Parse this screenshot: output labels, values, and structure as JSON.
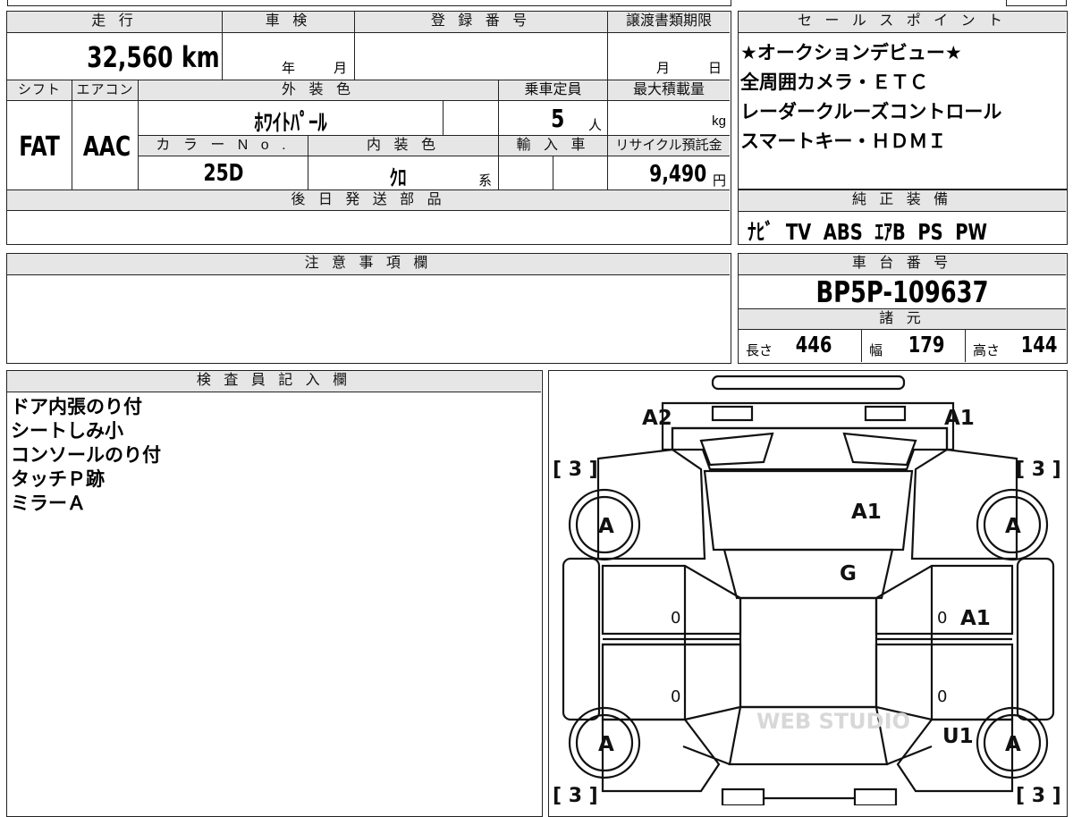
{
  "mileage": {
    "label": "走 行",
    "value": "32,560",
    "unit": "km"
  },
  "shaken": {
    "label": "車 検",
    "year_unit": "年",
    "month_unit": "月"
  },
  "registration": {
    "label": "登 録 番 号",
    "value": ""
  },
  "transfer_deadline": {
    "label": "譲渡書類期限",
    "month_unit": "月",
    "day_unit": "日"
  },
  "shift": {
    "label": "シフト",
    "value": "FAT"
  },
  "aircon": {
    "label": "エアコン",
    "value": "AAC"
  },
  "exterior_color": {
    "label": "外 装 色",
    "value": "ﾎﾜｲﾄﾊﾟｰﾙ"
  },
  "capacity": {
    "label": "乗車定員",
    "value": "5",
    "unit": "人"
  },
  "max_load": {
    "label": "最大積載量",
    "unit": "kg"
  },
  "color_no": {
    "label": "カ ラ ー N o .",
    "value": "25D"
  },
  "interior_color": {
    "label": "内 装 色",
    "value": "ｸﾛ",
    "suffix": "系"
  },
  "import": {
    "label": "輸 入 車"
  },
  "recycle": {
    "label": "リサイクル預託金",
    "value": "9,490",
    "unit": "円"
  },
  "later_parts": {
    "label": "後 日 発 送 部 品"
  },
  "sales_points": {
    "label": "セ ー ル ス ポ イ ン ト",
    "lines": [
      "★オークションデビュー★",
      "全周囲カメラ・ＥＴＣ",
      "レーダークルーズコントロール",
      "スマートキー・ＨＤＭＩ"
    ]
  },
  "equipment": {
    "label": "純 正 装 備",
    "value": "ﾅﾋﾞ  TV  ABS  ｴｱB  PS  PW"
  },
  "notes": {
    "label": "注 意 事 項 欄"
  },
  "chassis": {
    "label": "車 台 番 号",
    "value": "BP5P-109637"
  },
  "specs": {
    "label": "諸 元",
    "length_label": "長さ",
    "length": "446",
    "width_label": "幅",
    "width": "179",
    "height_label": "高さ",
    "height": "144"
  },
  "inspector": {
    "label": "検 査 員 記 入 欄",
    "lines": [
      "ドア内張のり付",
      "シートしみ小",
      "コンソールのり付",
      "タッチＰ跡",
      "ミラーＡ"
    ]
  },
  "diagram": {
    "marks": {
      "front_left": "A2",
      "front_right": "A1",
      "windshield": "A1",
      "roof": "G",
      "right_front_door": "A1",
      "rear_right": "U1",
      "tire_fl": "A",
      "tire_fr": "A",
      "tire_rl": "A",
      "tire_rr": "A",
      "tread_fl": "[ 3 ]",
      "tread_fr": "[ 3 ]",
      "tread_rl": "[ 3 ]",
      "tread_rr": "[ 3 ]",
      "door_l1": "0",
      "door_l2": "0",
      "door_r1": "0",
      "door_r2": "0"
    },
    "watermark": "WEB STUDIO"
  }
}
